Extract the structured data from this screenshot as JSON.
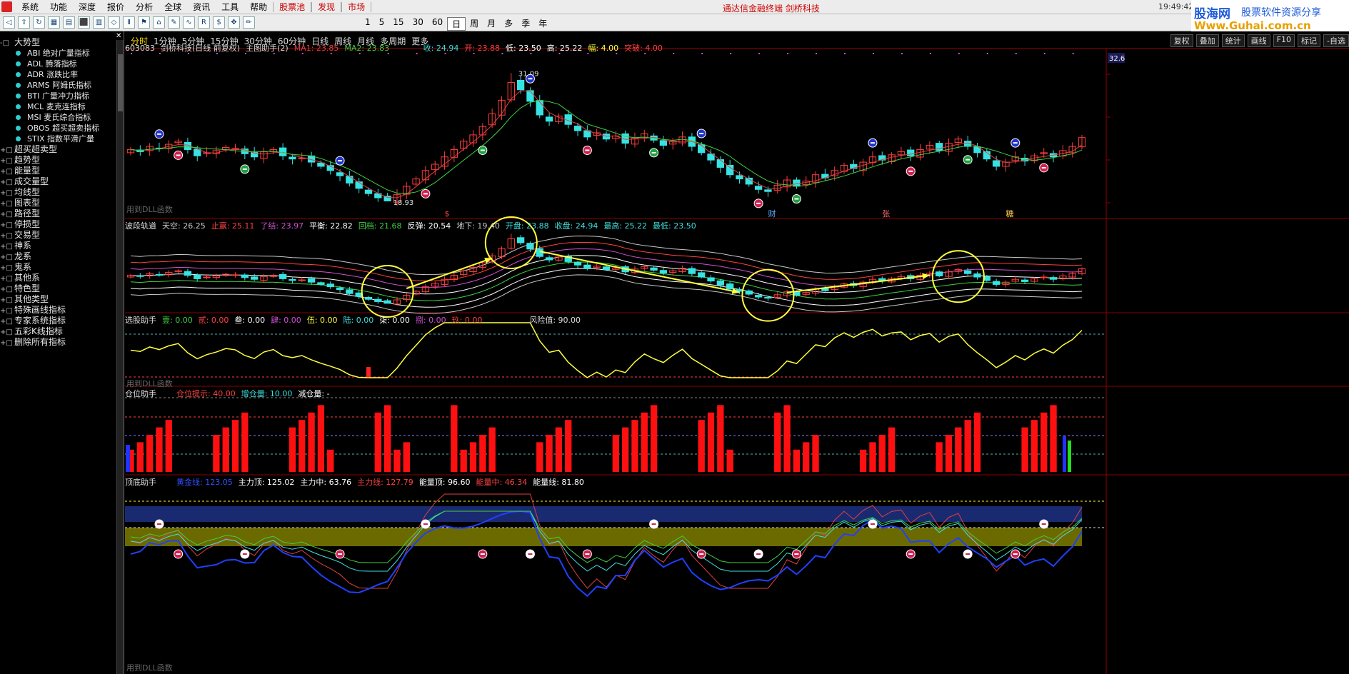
{
  "menu": {
    "items": [
      "系统",
      "功能",
      "深度",
      "报价",
      "分析",
      "全球",
      "资讯",
      "工具",
      "帮助"
    ],
    "hot_items": [
      "股票池",
      "发现",
      "市场"
    ],
    "window_title": "通达信金融终端 剑桥科技",
    "clock": "19:49:42"
  },
  "brand": {
    "name": "股海网",
    "tagline": "股票软件资源分享",
    "url": "Www.Guhai.com.cn"
  },
  "toolbar": {
    "periods": [
      "1",
      "5",
      "15",
      "30",
      "60",
      "日",
      "周",
      "月",
      "多",
      "季",
      "年"
    ],
    "selected_period": "日"
  },
  "sidebar": {
    "root": {
      "label": "大势型",
      "toggle": "-"
    },
    "children": [
      "ABI 绝对广量指标",
      "ADL 腾落指标",
      "ADR 涨跌比率",
      "ARMS 阿姆氏指标",
      "BTI 广量冲力指标",
      "MCL 麦克连指标",
      "MSI 麦氏综合指标",
      "OBOS 超买超卖指标",
      "STIX 指数平滑广量"
    ],
    "groups": [
      "超买超卖型",
      "趋势型",
      "能量型",
      "成交量型",
      "均线型",
      "图表型",
      "路径型",
      "停损型",
      "交易型",
      "神系",
      "龙系",
      "鬼系",
      "其他系",
      "特色型",
      "其他类型",
      "特殊画线指标",
      "专家系统指标",
      "五彩K线指标",
      "删除所有指标"
    ]
  },
  "tabs": {
    "periods": [
      "分时",
      "1分钟",
      "5分钟",
      "15分钟",
      "30分钟",
      "60分钟",
      "日线",
      "周线",
      "月线",
      "多周期",
      "更多"
    ],
    "selected": "分时",
    "right_buttons": [
      "复权",
      "叠加",
      "统计",
      "画线",
      "F10",
      "标记",
      "-自选"
    ]
  },
  "panels": {
    "main": {
      "code": "603083",
      "name": "剑桥科技(日线 前复权)",
      "indicator": "主图助手(2)",
      "ma1": "MA1: 23.85",
      "ma2": "MA2: 23.83",
      "quote": [
        "收: 24.94",
        "开: 23.88",
        "低: 23.50",
        "高: 25.22",
        "幅: 4.00",
        "突破: 4.00"
      ],
      "high_label": "31.09",
      "low_label": "18.93",
      "price_right": "32.6",
      "events": [
        "$",
        "财",
        "张",
        "糖"
      ],
      "dll": "用到DLL函数"
    },
    "band": {
      "title": "波段轨道",
      "values": [
        "天空: 26.25",
        "止赢: 25.11",
        "了结: 23.97",
        "平衡: 22.82",
        "回档: 21.68",
        "反弹: 20.54",
        "地下: 19.40",
        "开盘: 23.88",
        "收盘: 24.94",
        "最高: 25.22",
        "最低: 23.50"
      ]
    },
    "pick": {
      "title": "选股助手",
      "values": [
        "壹: 0.00",
        "贰: 0.00",
        "叁: 0.00",
        "肆: 0.00",
        "伍: 0.00",
        "陆: 0.00",
        "柒: 0.00",
        "捌: 0.00",
        "玖: 0.00"
      ],
      "risk": "风险值: 90.00",
      "dll": "用到DLL函数"
    },
    "position": {
      "title": "仓位助手",
      "values": [
        "仓位提示: 40.00",
        "增仓量: 10.00",
        "减仓量: -"
      ]
    },
    "topbottom": {
      "title": "顶底助手",
      "values": [
        "黄金线: 123.05",
        "主力顶: 125.02",
        "主力中: 63.76",
        "主力线: 127.79",
        "能量顶: 96.60",
        "能量中: 46.34",
        "能量线: 81.80"
      ],
      "dll": "用到DLL函数"
    }
  },
  "colors": {
    "up": "#ff3c3c",
    "down": "#36e3e3",
    "yellow": "#ffff3c",
    "ma1": "#e04040",
    "ma2": "#40d040",
    "purple": "#d050d0",
    "green_pale": "#70e070"
  },
  "chart_data": {
    "type": "candlestick",
    "close": [
      23.8,
      23.6,
      24.1,
      23.9,
      24.3,
      24.6,
      23.8,
      23.2,
      23.5,
      23.7,
      24.0,
      23.9,
      23.4,
      23.1,
      23.6,
      23.8,
      23.2,
      22.9,
      23.0,
      22.6,
      22.2,
      21.8,
      21.3,
      20.6,
      20.1,
      19.6,
      19.2,
      18.9,
      19.5,
      20.3,
      21.0,
      21.8,
      22.4,
      23.1,
      23.8,
      24.6,
      25.2,
      26.0,
      27.2,
      28.5,
      30.2,
      29.5,
      28.4,
      27.1,
      26.5,
      27.0,
      26.2,
      25.6,
      25.0,
      25.4,
      24.8,
      25.1,
      24.4,
      24.9,
      25.3,
      24.7,
      24.2,
      24.6,
      25.0,
      24.1,
      23.5,
      22.8,
      22.1,
      21.4,
      21.0,
      20.5,
      20.0,
      19.8,
      20.4,
      20.9,
      20.3,
      20.8,
      21.4,
      21.1,
      21.8,
      22.3,
      22.0,
      22.6,
      23.1,
      22.8,
      23.3,
      23.6,
      23.2,
      23.8,
      24.2,
      23.7,
      24.4,
      24.8,
      24.1,
      23.5,
      22.9,
      22.2,
      22.6,
      23.1,
      22.7,
      23.2,
      23.5,
      23.1,
      23.7,
      24.1,
      24.94
    ]
  }
}
